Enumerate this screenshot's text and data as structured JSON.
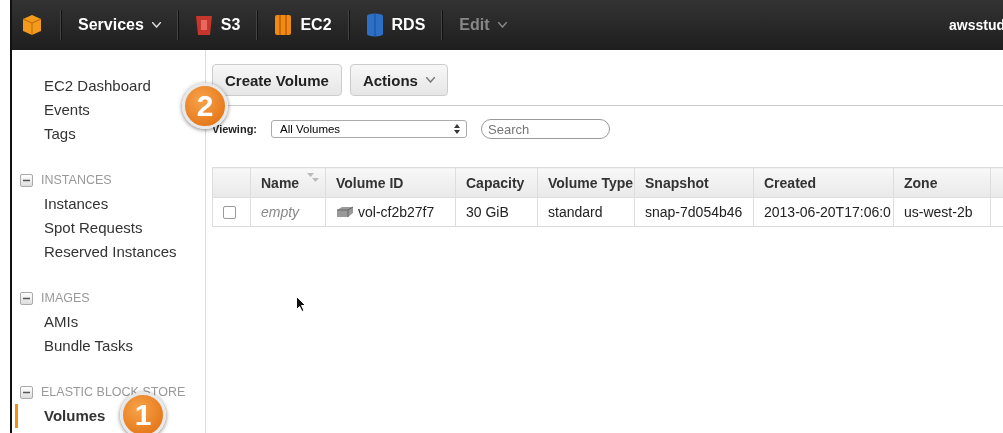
{
  "nav": {
    "items": [
      {
        "kind": "services",
        "label": "Services",
        "disabled": false
      },
      {
        "kind": "s3",
        "label": "S3",
        "disabled": false
      },
      {
        "kind": "ec2",
        "label": "EC2",
        "disabled": false
      },
      {
        "kind": "rds",
        "label": "RDS",
        "disabled": false
      },
      {
        "kind": "edit",
        "label": "Edit",
        "disabled": true
      }
    ],
    "user": "awsstud"
  },
  "sidebar": {
    "items": [
      "EC2 Dashboard",
      "Events",
      "Tags"
    ],
    "sections": [
      {
        "title": "INSTANCES",
        "expanded": true,
        "items": [
          {
            "label": "Instances",
            "selected": false
          },
          {
            "label": "Spot Requests",
            "selected": false
          },
          {
            "label": "Reserved Instances",
            "selected": false
          }
        ]
      },
      {
        "title": "IMAGES",
        "expanded": true,
        "items": [
          {
            "label": "AMIs",
            "selected": false
          },
          {
            "label": "Bundle Tasks",
            "selected": false
          }
        ]
      },
      {
        "title": "ELASTIC BLOCK STORE",
        "expanded": true,
        "items": [
          {
            "label": "Volumes",
            "selected": true
          }
        ]
      }
    ]
  },
  "toolbar": {
    "buttons": [
      {
        "label": "Create Volume",
        "dropdown": false
      },
      {
        "label": "Actions",
        "dropdown": true
      }
    ]
  },
  "filter": {
    "label": "Viewing:",
    "value": "All Volumes",
    "search_placeholder": "Search"
  },
  "table": {
    "columns": [
      {
        "label": "Name",
        "sortable": true
      },
      {
        "label": "Volume ID",
        "sortable": false
      },
      {
        "label": "Capacity",
        "sortable": false
      },
      {
        "label": "Volume Type",
        "sortable": false
      },
      {
        "label": "Snapshot",
        "sortable": false
      },
      {
        "label": "Created",
        "sortable": false
      },
      {
        "label": "Zone",
        "sortable": false
      }
    ],
    "rows": [
      {
        "checked": false,
        "name_is_placeholder": true,
        "cells": [
          "empty",
          "vol-cf2b27f7",
          "30 GiB",
          "standard",
          "snap-7d054b46",
          "2013-06-20T17:06:0",
          "us-west-2b"
        ]
      }
    ]
  },
  "callouts": [
    {
      "label": "2"
    },
    {
      "label": "1"
    }
  ]
}
